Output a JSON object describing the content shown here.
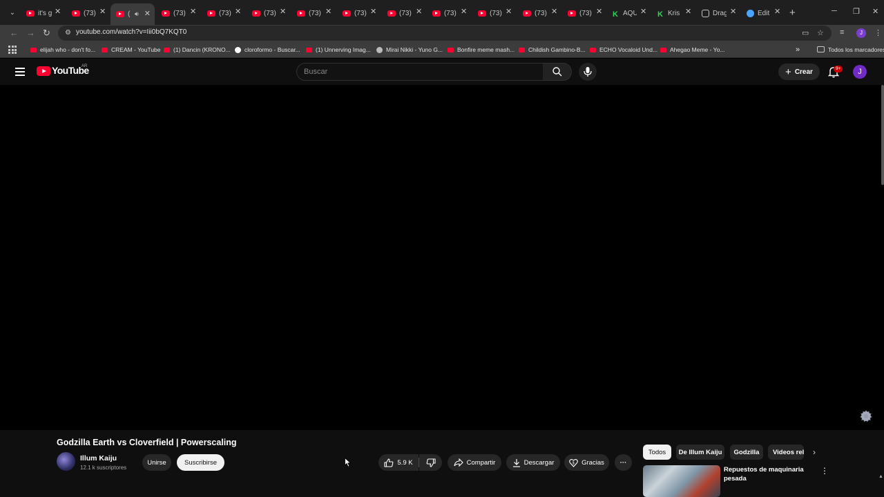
{
  "browser": {
    "tabs": [
      {
        "label": "it's g",
        "favicon": "youtube"
      },
      {
        "label": "(73)",
        "favicon": "youtube"
      },
      {
        "label": "(",
        "favicon": "youtube",
        "active": true
      },
      {
        "label": "(73)",
        "favicon": "youtube"
      },
      {
        "label": "(73)",
        "favicon": "youtube"
      },
      {
        "label": "(73)",
        "favicon": "youtube"
      },
      {
        "label": "(73)",
        "favicon": "youtube"
      },
      {
        "label": "(73)",
        "favicon": "youtube"
      },
      {
        "label": "(73)",
        "favicon": "youtube"
      },
      {
        "label": "(73)",
        "favicon": "youtube"
      },
      {
        "label": "(73)",
        "favicon": "youtube"
      },
      {
        "label": "(73)",
        "favicon": "youtube"
      },
      {
        "label": "(73)",
        "favicon": "youtube"
      },
      {
        "label": "AQU",
        "favicon": "kick"
      },
      {
        "label": "Kris",
        "favicon": "kick"
      },
      {
        "label": "Drag",
        "favicon": "generic"
      },
      {
        "label": "Edit",
        "favicon": "edge"
      }
    ],
    "url": "youtube.com/watch?v=Iii0bQ7KQT0",
    "profile_initial": "J",
    "bookmarks": [
      {
        "label": "elijah who - don't fo...",
        "favicon": "youtube"
      },
      {
        "label": "CREAM - YouTube",
        "favicon": "youtube"
      },
      {
        "label": "(1) Dancin (KRONO...",
        "favicon": "youtube"
      },
      {
        "label": "cloroformo - Buscar...",
        "favicon": "google"
      },
      {
        "label": "(1) Unnerving Imag...",
        "favicon": "youtube"
      },
      {
        "label": "Mirai Nikki - Yuno G...",
        "favicon": "steam"
      },
      {
        "label": "Bonfire meme mash...",
        "favicon": "youtube"
      },
      {
        "label": "Childish Gambino-B...",
        "favicon": "youtube"
      },
      {
        "label": "ECHO Vocaloid Und...",
        "favicon": "youtube"
      },
      {
        "label": "Ahegao Meme - Yo...",
        "favicon": "youtube"
      }
    ],
    "bookmarks_overflow": "»",
    "all_bookmarks_label": "Todos los marcadores"
  },
  "youtube": {
    "logo_text": "YouTube",
    "country_code": "AR",
    "search_placeholder": "Buscar",
    "create_label": "Crear",
    "notification_count": "9+",
    "avatar_initial": "J"
  },
  "video": {
    "title": "Godzilla Earth vs Cloverfield | Powerscaling",
    "channel_name": "Illum Kaiju",
    "subscribers": "12.1 k suscriptores",
    "join_label": "Unirse",
    "subscribe_label": "Suscribirse",
    "likes": "5.9 K",
    "share_label": "Compartir",
    "download_label": "Descargar",
    "thanks_label": "Gracias",
    "more_label": "···"
  },
  "sidebar": {
    "chips": [
      "Todos",
      "De Illum Kaiju",
      "Godzilla",
      "Videos rel"
    ],
    "recommendation_title": "Repuestos de maquinaria pesada"
  },
  "colors": {
    "youtube_red": "#ff0033",
    "background": "#0f0f0f",
    "chip_bg": "#272727"
  }
}
